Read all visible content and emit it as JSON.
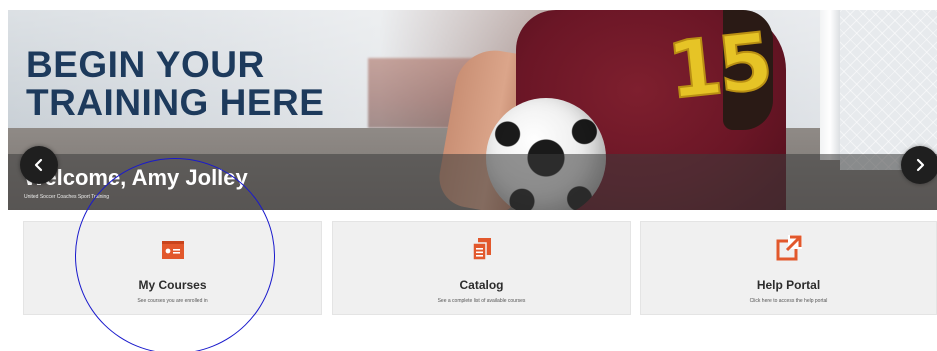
{
  "hero": {
    "headline_line1": "BEGIN YOUR",
    "headline_line2": "TRAINING HERE",
    "welcome": "Welcome, Amy Jolley",
    "welcome_sub": "United Soccer Coaches Sport Training",
    "jersey_number": "15",
    "prev_icon": "chevron-left-icon",
    "next_icon": "chevron-right-icon"
  },
  "tiles": [
    {
      "title": "My Courses",
      "description": "See courses you are enrolled in",
      "icon": "id-card-icon"
    },
    {
      "title": "Catalog",
      "description": "See a complete list of available courses",
      "icon": "catalog-copy-icon"
    },
    {
      "title": "Help Portal",
      "description": "Click here to access the help portal",
      "icon": "external-link-icon"
    }
  ],
  "colors": {
    "accent": "#e2582c",
    "headline": "#1d3a5c",
    "tile_bg": "#f0f0f0",
    "annotation": "#1a1acc"
  }
}
